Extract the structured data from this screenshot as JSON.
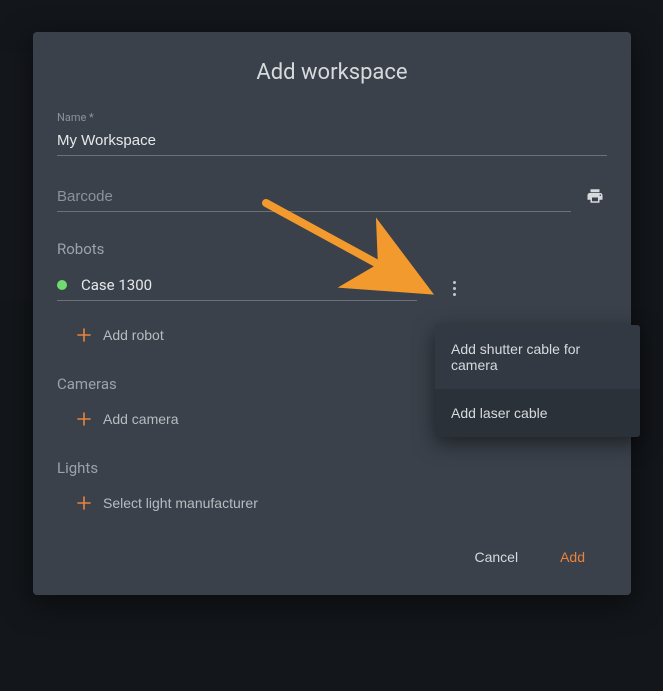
{
  "dialog": {
    "title": "Add workspace",
    "name_label": "Name *",
    "name_value": "My Workspace",
    "barcode_placeholder": "Barcode",
    "barcode_value": ""
  },
  "sections": {
    "robots_label": "Robots",
    "cameras_label": "Cameras",
    "lights_label": "Lights"
  },
  "robot": {
    "selected": "Case 1300",
    "status_color": "#6fdc6f"
  },
  "actions": {
    "add_robot": "Add robot",
    "add_camera": "Add camera",
    "select_light": "Select light manufacturer",
    "cancel": "Cancel",
    "add": "Add"
  },
  "menu": {
    "items": [
      "Add shutter cable for camera",
      "Add laser cable"
    ]
  },
  "colors": {
    "accent": "#e8833d",
    "dialog_bg": "#3a414a",
    "popup_bg": "#2b3138"
  }
}
